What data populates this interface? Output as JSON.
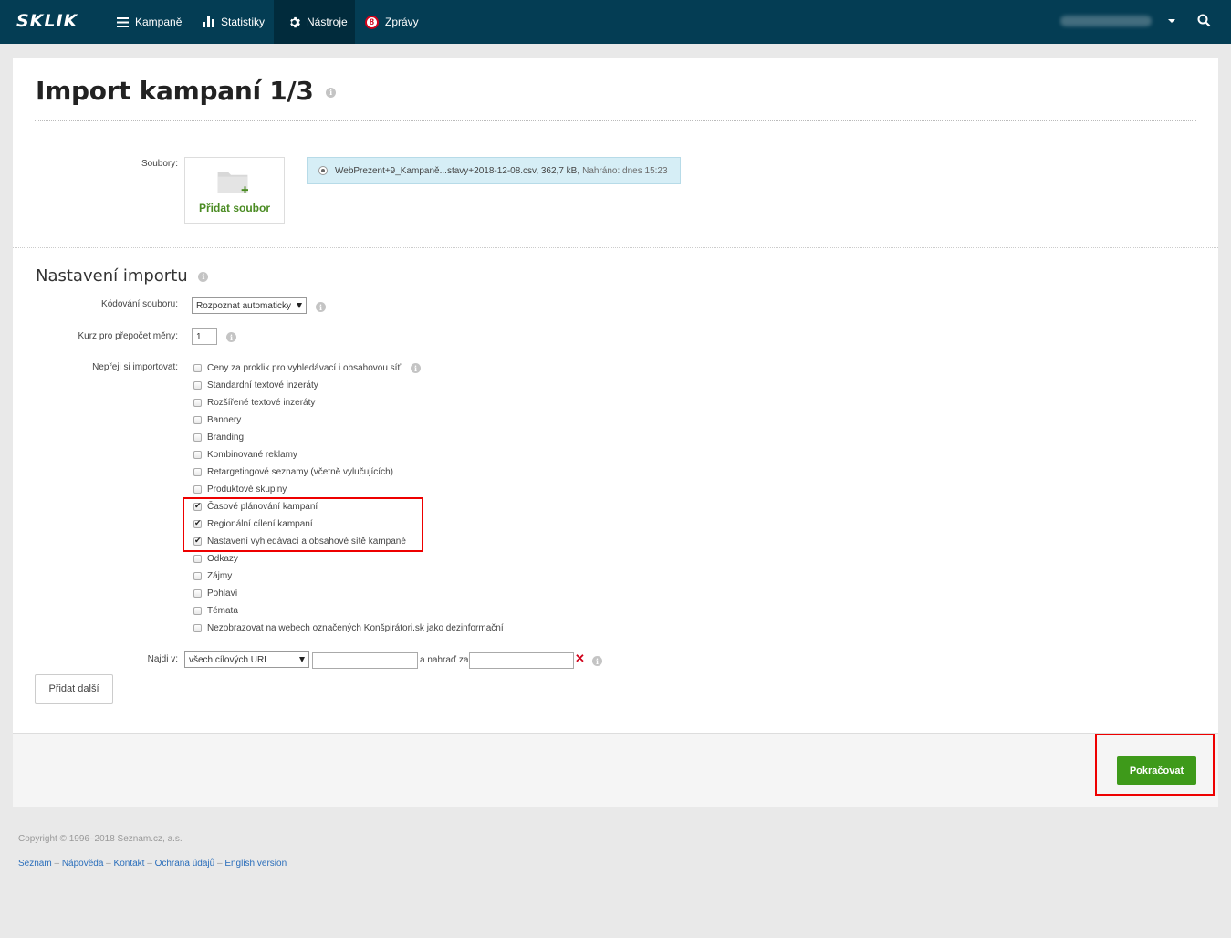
{
  "nav": {
    "logo": "SKLIK",
    "items": [
      {
        "label": "Kampaně",
        "icon": "menu-icon"
      },
      {
        "label": "Statistiky",
        "icon": "bar-chart-icon"
      },
      {
        "label": "Nástroje",
        "icon": "gear-icon"
      },
      {
        "label": "Zprávy",
        "icon": "messages-badge-icon",
        "badge": "8"
      }
    ],
    "active": "Nástroje"
  },
  "page": {
    "title": "Import kampaní 1/3"
  },
  "files": {
    "label": "Soubory:",
    "add_button": "Přidat soubor",
    "uploaded_name": "WebPrezent+9_Kampaně...stavy+2018-12-08.csv, 362,7 kB,",
    "uploaded_meta": "Nahráno: dnes 15:23"
  },
  "settings": {
    "title": "Nastavení importu",
    "encoding_label": "Kódování souboru:",
    "encoding_value": "Rozpoznat automaticky",
    "rate_label": "Kurz pro přepočet měny:",
    "rate_value": "1",
    "exclude_label": "Nepřeji si importovat:",
    "options": [
      {
        "label": "Ceny za proklik pro vyhledávací i obsahovou síť",
        "checked": false
      },
      {
        "label": "Standardní textové inzeráty",
        "checked": false
      },
      {
        "label": "Rozšířené textové inzeráty",
        "checked": false
      },
      {
        "label": "Bannery",
        "checked": false
      },
      {
        "label": "Branding",
        "checked": false
      },
      {
        "label": "Kombinované reklamy",
        "checked": false
      },
      {
        "label": "Retargetingové seznamy (včetně vylučujících)",
        "checked": false
      },
      {
        "label": "Produktové skupiny",
        "checked": false
      },
      {
        "label": "Časové plánování kampaní",
        "checked": true
      },
      {
        "label": "Regionální cílení kampaní",
        "checked": true
      },
      {
        "label": "Nastavení vyhledávací a obsahové sítě kampané",
        "checked": true
      },
      {
        "label": "Odkazy",
        "checked": false
      },
      {
        "label": "Zájmy",
        "checked": false
      },
      {
        "label": "Pohlaví",
        "checked": false
      },
      {
        "label": "Témata",
        "checked": false
      },
      {
        "label": "Nezobrazovat na webech označených Konšpirátori.sk jako dezinformační",
        "checked": false
      }
    ],
    "find_label": "Najdi v:",
    "find_select": "všech cílových URL",
    "find_value": "",
    "replace_label": "a nahraď za",
    "replace_value": "",
    "add_more": "Přidat další"
  },
  "actions": {
    "continue": "Pokračovat"
  },
  "footer": {
    "copyright": "Copyright © 1996–2018 Seznam.cz, a.s.",
    "links": [
      "Seznam",
      "Nápověda",
      "Kontakt",
      "Ochrana údajů",
      "English version"
    ],
    "separator": " – "
  }
}
